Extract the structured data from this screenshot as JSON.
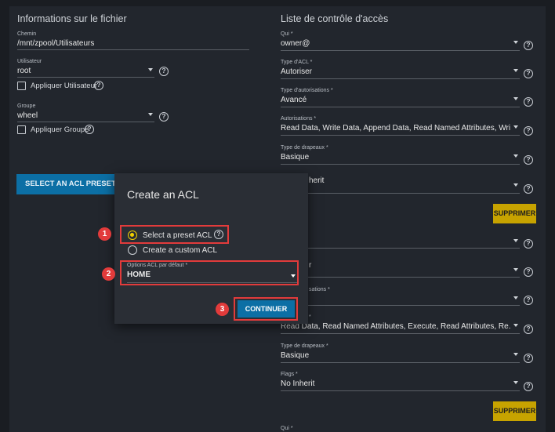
{
  "left": {
    "title": "Informations sur le fichier",
    "path": {
      "label": "Chemin",
      "value": "/mnt/zpool/Utilisateurs"
    },
    "user": {
      "label": "Utilisateur",
      "value": "root",
      "apply_label": "Appliquer Utilisateur"
    },
    "group": {
      "label": "Groupe",
      "value": "wheel",
      "apply_label": "Appliquer Groupe"
    },
    "preset_button": "SELECT AN ACL PRESET"
  },
  "right": {
    "title": "Liste de contrôle d'accès",
    "fields": [
      {
        "label": "Qui *",
        "value": "owner@"
      },
      {
        "label": "Type d'ACL *",
        "value": "Autoriser"
      },
      {
        "label": "Type d'autorisations *",
        "value": "Avancé"
      },
      {
        "label": "Autorisations *",
        "value": "Read Data, Write Data, Append Data, Read Named Attributes, Wri..."
      },
      {
        "label": "Type de drapeaux *",
        "value": "Basique"
      },
      {
        "label": "",
        "value": "herit"
      },
      {
        "label": "",
        "value": ""
      },
      {
        "label": "",
        "value": "r"
      },
      {
        "label": "sations *",
        "value": ""
      },
      {
        "label": "*",
        "value": "Read Data, Read Named Attributes, Execute, Read Attributes, Re..."
      },
      {
        "label": "Type de drapeaux *",
        "value": "Basique"
      },
      {
        "label": "Flags *",
        "value": "No Inherit"
      },
      {
        "label": "Qui *",
        "value": ""
      }
    ],
    "delete_label": "SUPPRIMER"
  },
  "help_glyph": "?",
  "modal": {
    "title": "Create an ACL",
    "radio_preset": "Select a preset ACL",
    "radio_custom": "Create a custom ACL",
    "select_label": "Options ACL par défaut *",
    "select_value": "HOME",
    "continue": "CONTINUER"
  },
  "badges": [
    "1",
    "2",
    "3"
  ],
  "colors": {
    "accent_blue": "#0c6fa5",
    "warn_yellow": "#c7a300",
    "callout_red": "#e23b3b",
    "radio_yellow": "#f2d100"
  }
}
